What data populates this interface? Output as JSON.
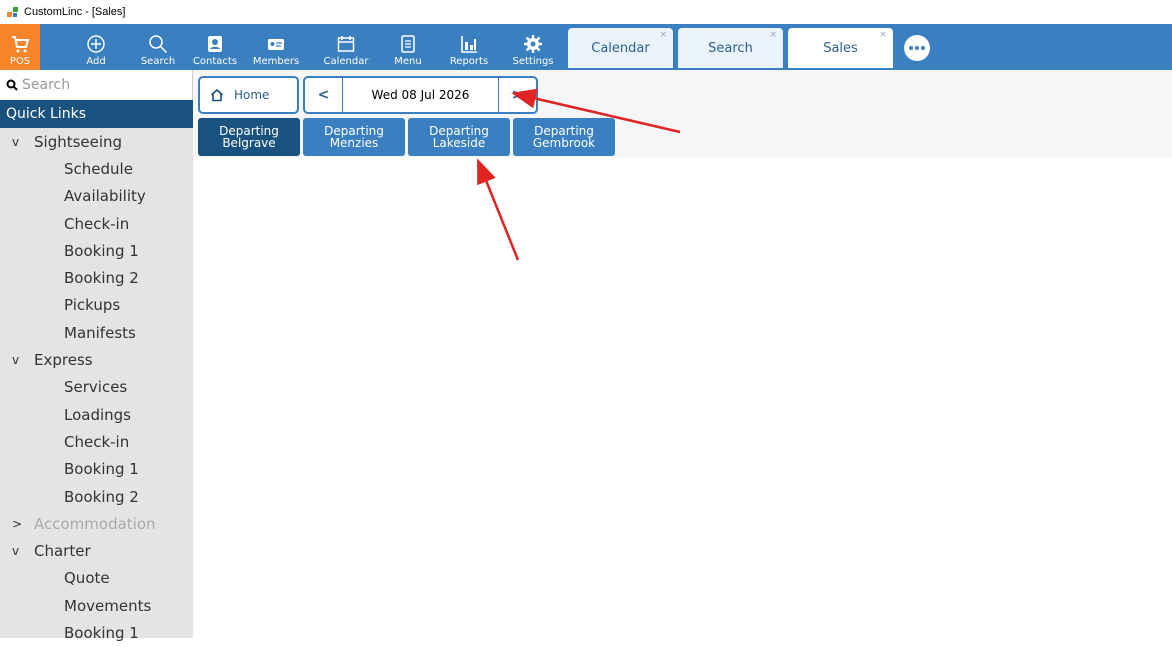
{
  "window": {
    "title": "CustomLinc - [Sales]"
  },
  "toolbar": {
    "buttons": [
      {
        "label": "POS",
        "icon": "cart-icon"
      },
      {
        "label": "Add",
        "icon": "plus-circle-icon"
      },
      {
        "label": "Search",
        "icon": "search-icon"
      },
      {
        "label": "Contacts",
        "icon": "contacts-icon"
      },
      {
        "label": "Members",
        "icon": "member-card-icon"
      },
      {
        "label": "Calendar",
        "icon": "calendar-icon"
      },
      {
        "label": "Menu",
        "icon": "menu-doc-icon"
      },
      {
        "label": "Reports",
        "icon": "bar-chart-icon"
      },
      {
        "label": "Settings",
        "icon": "gear-icon"
      }
    ],
    "tabs": [
      {
        "label": "Calendar",
        "close": "×"
      },
      {
        "label": "Search",
        "close": "×"
      },
      {
        "label": "Sales",
        "close": "×"
      }
    ]
  },
  "sidebar": {
    "search_placeholder": "Search",
    "quick_links_label": "Quick Links",
    "items": [
      {
        "label": "Sightseeing",
        "chevron": "v"
      },
      {
        "label": "Schedule"
      },
      {
        "label": "Availability"
      },
      {
        "label": "Check-in"
      },
      {
        "label": "Booking 1"
      },
      {
        "label": "Booking 2"
      },
      {
        "label": "Pickups"
      },
      {
        "label": "Manifests"
      },
      {
        "label": "Express",
        "chevron": "v"
      },
      {
        "label": "Services"
      },
      {
        "label": "Loadings"
      },
      {
        "label": "Check-in"
      },
      {
        "label": "Booking 1"
      },
      {
        "label": "Booking 2"
      },
      {
        "label": "Accommodation",
        "chevron": ">"
      },
      {
        "label": "Charter",
        "chevron": "v"
      },
      {
        "label": "Quote"
      },
      {
        "label": "Movements"
      },
      {
        "label": "Booking 1"
      }
    ]
  },
  "main": {
    "home_label": "Home",
    "prev_arrow": "<",
    "next_arrow": ">",
    "date": "Wed 08 Jul 2026",
    "departures": [
      {
        "line1": "Departing",
        "line2": "Belgrave"
      },
      {
        "line1": "Departing",
        "line2": "Menzies"
      },
      {
        "line1": "Departing",
        "line2": "Lakeside"
      },
      {
        "line1": "Departing",
        "line2": "Gembrook"
      }
    ]
  },
  "colors": {
    "toolbar": "#3a7fbf",
    "pos": "#f5842a",
    "quick_links": "#19527f",
    "annotation_arrow": "#e02424"
  }
}
